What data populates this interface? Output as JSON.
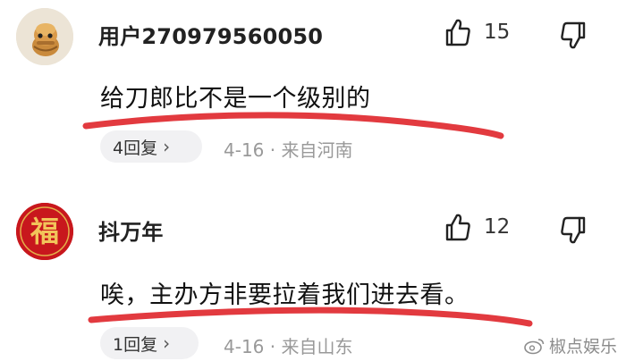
{
  "comments": [
    {
      "username": "用户270979560050",
      "likes": "15",
      "content": "给刀郎比不是一个级别的",
      "replies_label": "4回复",
      "date": "4-16",
      "location": "来自河南",
      "avatar_icon": "cartoon-bread-avatar-icon"
    },
    {
      "username": "抖万年",
      "likes": "12",
      "content": "唉，主办方非要拉着我们进去看。",
      "replies_label": "1回复",
      "date": "4-16",
      "location": "来自山东",
      "avatar_icon": "fu-character-avatar-icon",
      "avatar_glyph": "福"
    }
  ],
  "watermark": {
    "text": "椒点娱乐",
    "icon": "weibo-icon"
  },
  "colors": {
    "underline": "#e23a3f",
    "pill_bg": "#f1f1f3",
    "meta": "#999999"
  }
}
